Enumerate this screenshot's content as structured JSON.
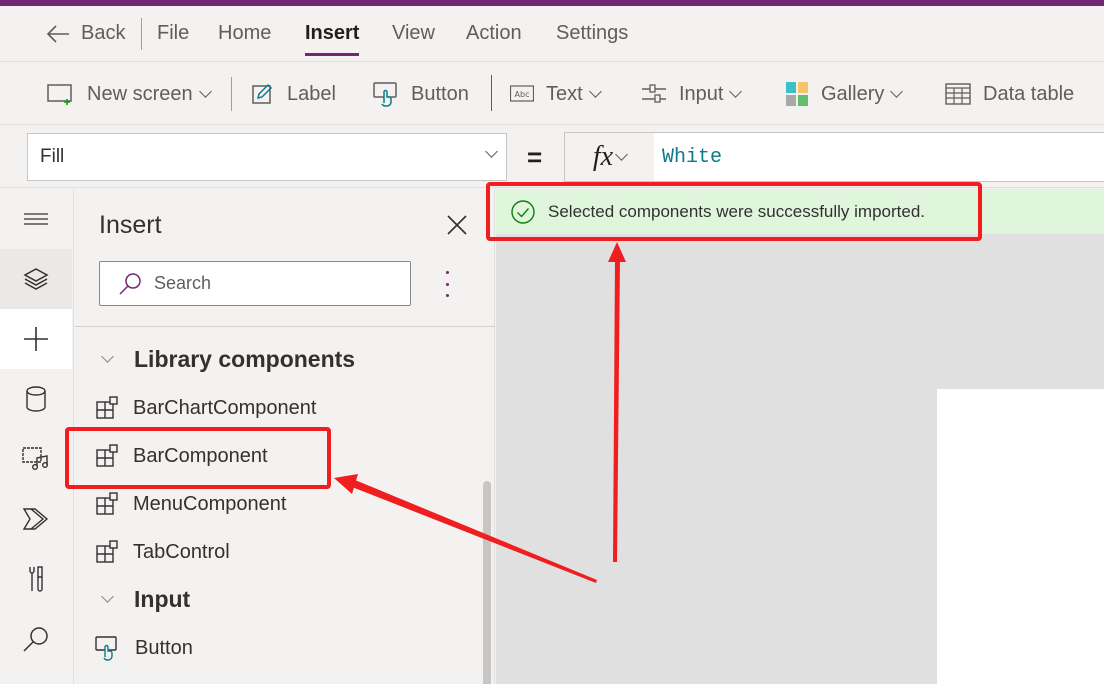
{
  "menubar": {
    "back_label": "Back",
    "tabs": [
      {
        "label": "File",
        "active": false
      },
      {
        "label": "Home",
        "active": false
      },
      {
        "label": "Insert",
        "active": true
      },
      {
        "label": "View",
        "active": false
      },
      {
        "label": "Action",
        "active": false
      },
      {
        "label": "Settings",
        "active": false
      }
    ]
  },
  "toolbar": {
    "new_screen": "New screen",
    "label": "Label",
    "button": "Button",
    "text": "Text",
    "input": "Input",
    "gallery": "Gallery",
    "data_table": "Data table"
  },
  "formula_bar": {
    "property": "Fill",
    "equals": "=",
    "fx": "fx",
    "formula": "White"
  },
  "notification": {
    "message": "Selected components were successfully imported.",
    "type": "success"
  },
  "rail": {
    "items": [
      {
        "icon": "hamburger-icon"
      },
      {
        "icon": "layers-icon"
      },
      {
        "icon": "plus-icon",
        "active": true
      },
      {
        "icon": "database-icon"
      },
      {
        "icon": "media-icon"
      },
      {
        "icon": "power-automate-icon"
      },
      {
        "icon": "tools-icon"
      },
      {
        "icon": "search-icon"
      }
    ]
  },
  "insert_panel": {
    "title": "Insert",
    "search_placeholder": "Search",
    "sections": [
      {
        "label": "Library components",
        "items": [
          "BarChartComponent",
          "BarComponent",
          "MenuComponent",
          "TabControl"
        ]
      },
      {
        "label": "Input",
        "items": [
          "Button"
        ]
      }
    ]
  },
  "colors": {
    "brand": "#742774",
    "success_bg": "#dff6dd",
    "success_icon": "#107c10",
    "annotation": "#f01e1e",
    "formula_text": "#0b7b8b"
  }
}
